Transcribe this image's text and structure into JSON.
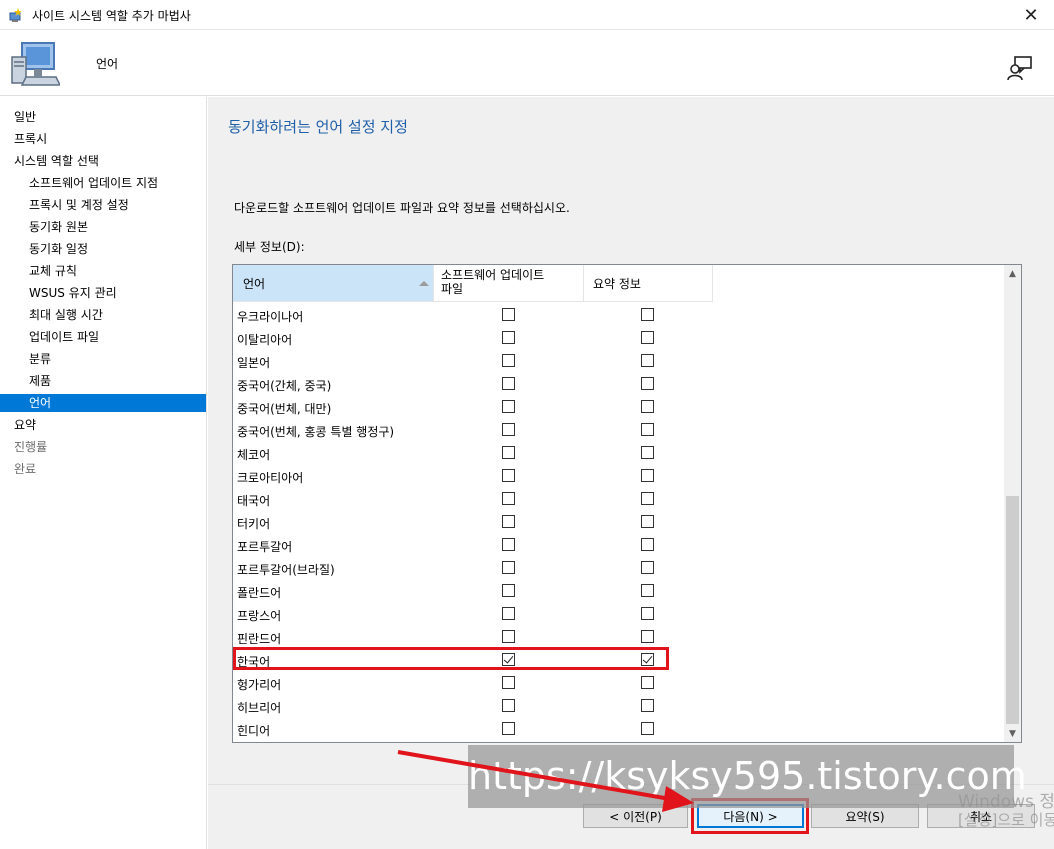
{
  "window": {
    "title": "사이트 시스템 역할 추가 마법사",
    "close_glyph": "✕"
  },
  "header": {
    "page_title": "언어"
  },
  "sidebar": {
    "items": [
      {
        "label": "일반",
        "level": "top",
        "state": "normal"
      },
      {
        "label": "프록시",
        "level": "top",
        "state": "normal"
      },
      {
        "label": "시스템 역할 선택",
        "level": "top",
        "state": "normal"
      },
      {
        "label": "소프트웨어 업데이트 지점",
        "level": "sub",
        "state": "normal"
      },
      {
        "label": "프록시 및 계정 설정",
        "level": "sub",
        "state": "normal"
      },
      {
        "label": "동기화 원본",
        "level": "sub",
        "state": "normal"
      },
      {
        "label": "동기화 일정",
        "level": "sub",
        "state": "normal"
      },
      {
        "label": "교체 규칙",
        "level": "sub",
        "state": "normal"
      },
      {
        "label": "WSUS 유지 관리",
        "level": "sub",
        "state": "normal"
      },
      {
        "label": "최대 실행 시간",
        "level": "sub",
        "state": "normal"
      },
      {
        "label": "업데이트 파일",
        "level": "sub",
        "state": "normal"
      },
      {
        "label": "분류",
        "level": "sub",
        "state": "normal"
      },
      {
        "label": "제품",
        "level": "sub",
        "state": "normal"
      },
      {
        "label": "언어",
        "level": "sub",
        "state": "selected"
      },
      {
        "label": "요약",
        "level": "top",
        "state": "normal"
      },
      {
        "label": "진행률",
        "level": "top",
        "state": "disabled"
      },
      {
        "label": "완료",
        "level": "top",
        "state": "disabled"
      }
    ]
  },
  "main": {
    "section_title": "동기화하려는 언어 설정 지정",
    "instruction": "다운로드할 소프트웨어 업데이트 파일과 요약 정보를 선택하십시오.",
    "details_label": "세부 정보(D):",
    "columns": {
      "language": "언어",
      "update_files_line1": "소프트웨어 업데이트",
      "update_files_line2": "파일",
      "summary": "요약 정보"
    },
    "rows": [
      {
        "language": "우크라이나어",
        "update_files": false,
        "summary": false
      },
      {
        "language": "이탈리아어",
        "update_files": false,
        "summary": false
      },
      {
        "language": "일본어",
        "update_files": false,
        "summary": false
      },
      {
        "language": "중국어(간체, 중국)",
        "update_files": false,
        "summary": false
      },
      {
        "language": "중국어(번체, 대만)",
        "update_files": false,
        "summary": false
      },
      {
        "language": "중국어(번체, 홍콩 특별 행정구)",
        "update_files": false,
        "summary": false
      },
      {
        "language": "체코어",
        "update_files": false,
        "summary": false
      },
      {
        "language": "크로아티아어",
        "update_files": false,
        "summary": false
      },
      {
        "language": "태국어",
        "update_files": false,
        "summary": false
      },
      {
        "language": "터키어",
        "update_files": false,
        "summary": false
      },
      {
        "language": "포르투갈어",
        "update_files": false,
        "summary": false
      },
      {
        "language": "포르투갈어(브라질)",
        "update_files": false,
        "summary": false
      },
      {
        "language": "폴란드어",
        "update_files": false,
        "summary": false
      },
      {
        "language": "프랑스어",
        "update_files": false,
        "summary": false
      },
      {
        "language": "핀란드어",
        "update_files": false,
        "summary": false
      },
      {
        "language": "한국어",
        "update_files": true,
        "summary": true
      },
      {
        "language": "헝가리어",
        "update_files": false,
        "summary": false
      },
      {
        "language": "히브리어",
        "update_files": false,
        "summary": false
      },
      {
        "language": "힌디어",
        "update_files": false,
        "summary": false
      }
    ]
  },
  "buttons": {
    "prev": "< 이전(P)",
    "next": "다음(N) >",
    "summary": "요약(S)",
    "cancel": "취소"
  },
  "overlay": {
    "watermark": "https://ksyksy595.tistory.com",
    "windows_activate_line1": "Windows 정",
    "windows_activate_line2": "[설정]으로 이동",
    "highlight_color": "#e0141a"
  },
  "colors": {
    "accent": "#0078d7",
    "section_title": "#1f5fa8",
    "selection_header": "#cce4f7"
  }
}
